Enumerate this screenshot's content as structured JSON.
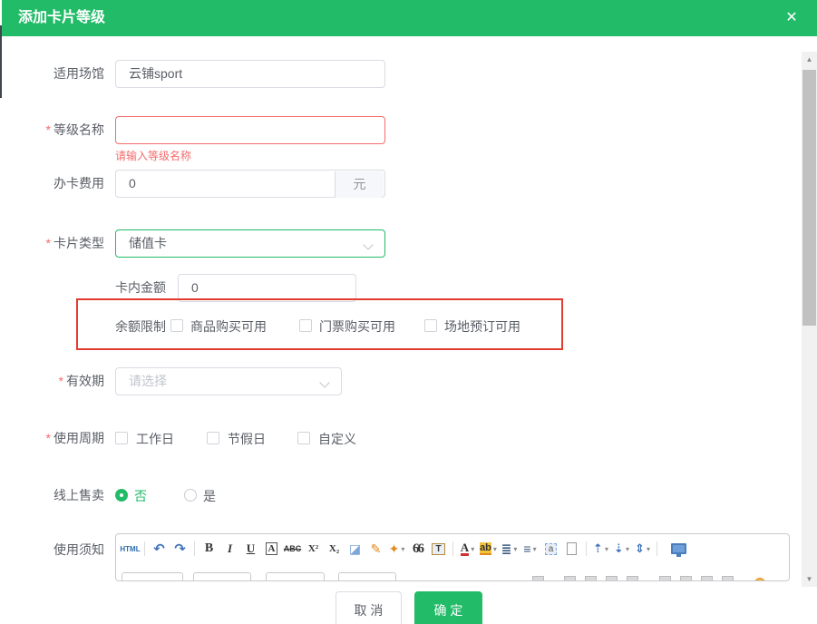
{
  "window": {
    "title": "添加卡片等级",
    "close_glyph": "✕"
  },
  "required_mark": "*",
  "form": {
    "venue": {
      "label": "适用场馆",
      "value": "云铺sport"
    },
    "level_name": {
      "label": "等级名称",
      "value": "",
      "error": "请输入等级名称"
    },
    "card_fee": {
      "label": "办卡费用",
      "value": "0",
      "unit": "元"
    },
    "card_type": {
      "label": "卡片类型",
      "value": "储值卡"
    },
    "card_amount": {
      "label": "卡内金额",
      "value": "0"
    },
    "balance_limit": {
      "label": "余额限制",
      "options": [
        "商品购买可用",
        "门票购买可用",
        "场地预订可用"
      ]
    },
    "validity": {
      "label": "有效期",
      "placeholder": "请选择"
    },
    "usage_cycle": {
      "label": "使用周期",
      "options": [
        "工作日",
        "节假日",
        "自定义"
      ]
    },
    "online_sale": {
      "label": "线上售卖",
      "option_no": "否",
      "option_yes": "是",
      "selected": "否"
    },
    "usage_notes": {
      "label": "使用须知"
    }
  },
  "editor": {
    "icons": {
      "html": "HTML",
      "undo": "↶",
      "redo": "↷",
      "bold": "B",
      "italic": "I",
      "underline": "U",
      "font_box": "A",
      "strike": "ABC",
      "superscript": "X²",
      "subscript": "X₂",
      "eraser": "◪",
      "brush": "✎",
      "wand": "✦",
      "quote": "66",
      "paste_text": "T",
      "font_color": "A",
      "highlight": "ab",
      "ordered_list": "≣",
      "unordered_list": "≡",
      "anchor": "a",
      "space_before": "⇡",
      "space_after": "⇣",
      "line_height": "⇕",
      "dropdown": "▾"
    }
  },
  "footer": {
    "cancel": "取 消",
    "confirm": "确 定"
  },
  "scrollbar": {
    "up_glyph": "▲",
    "down_glyph": "▼"
  },
  "colors": {
    "primary": "#22bb68",
    "error": "#f56c6c",
    "annotation": "#e23b30"
  }
}
